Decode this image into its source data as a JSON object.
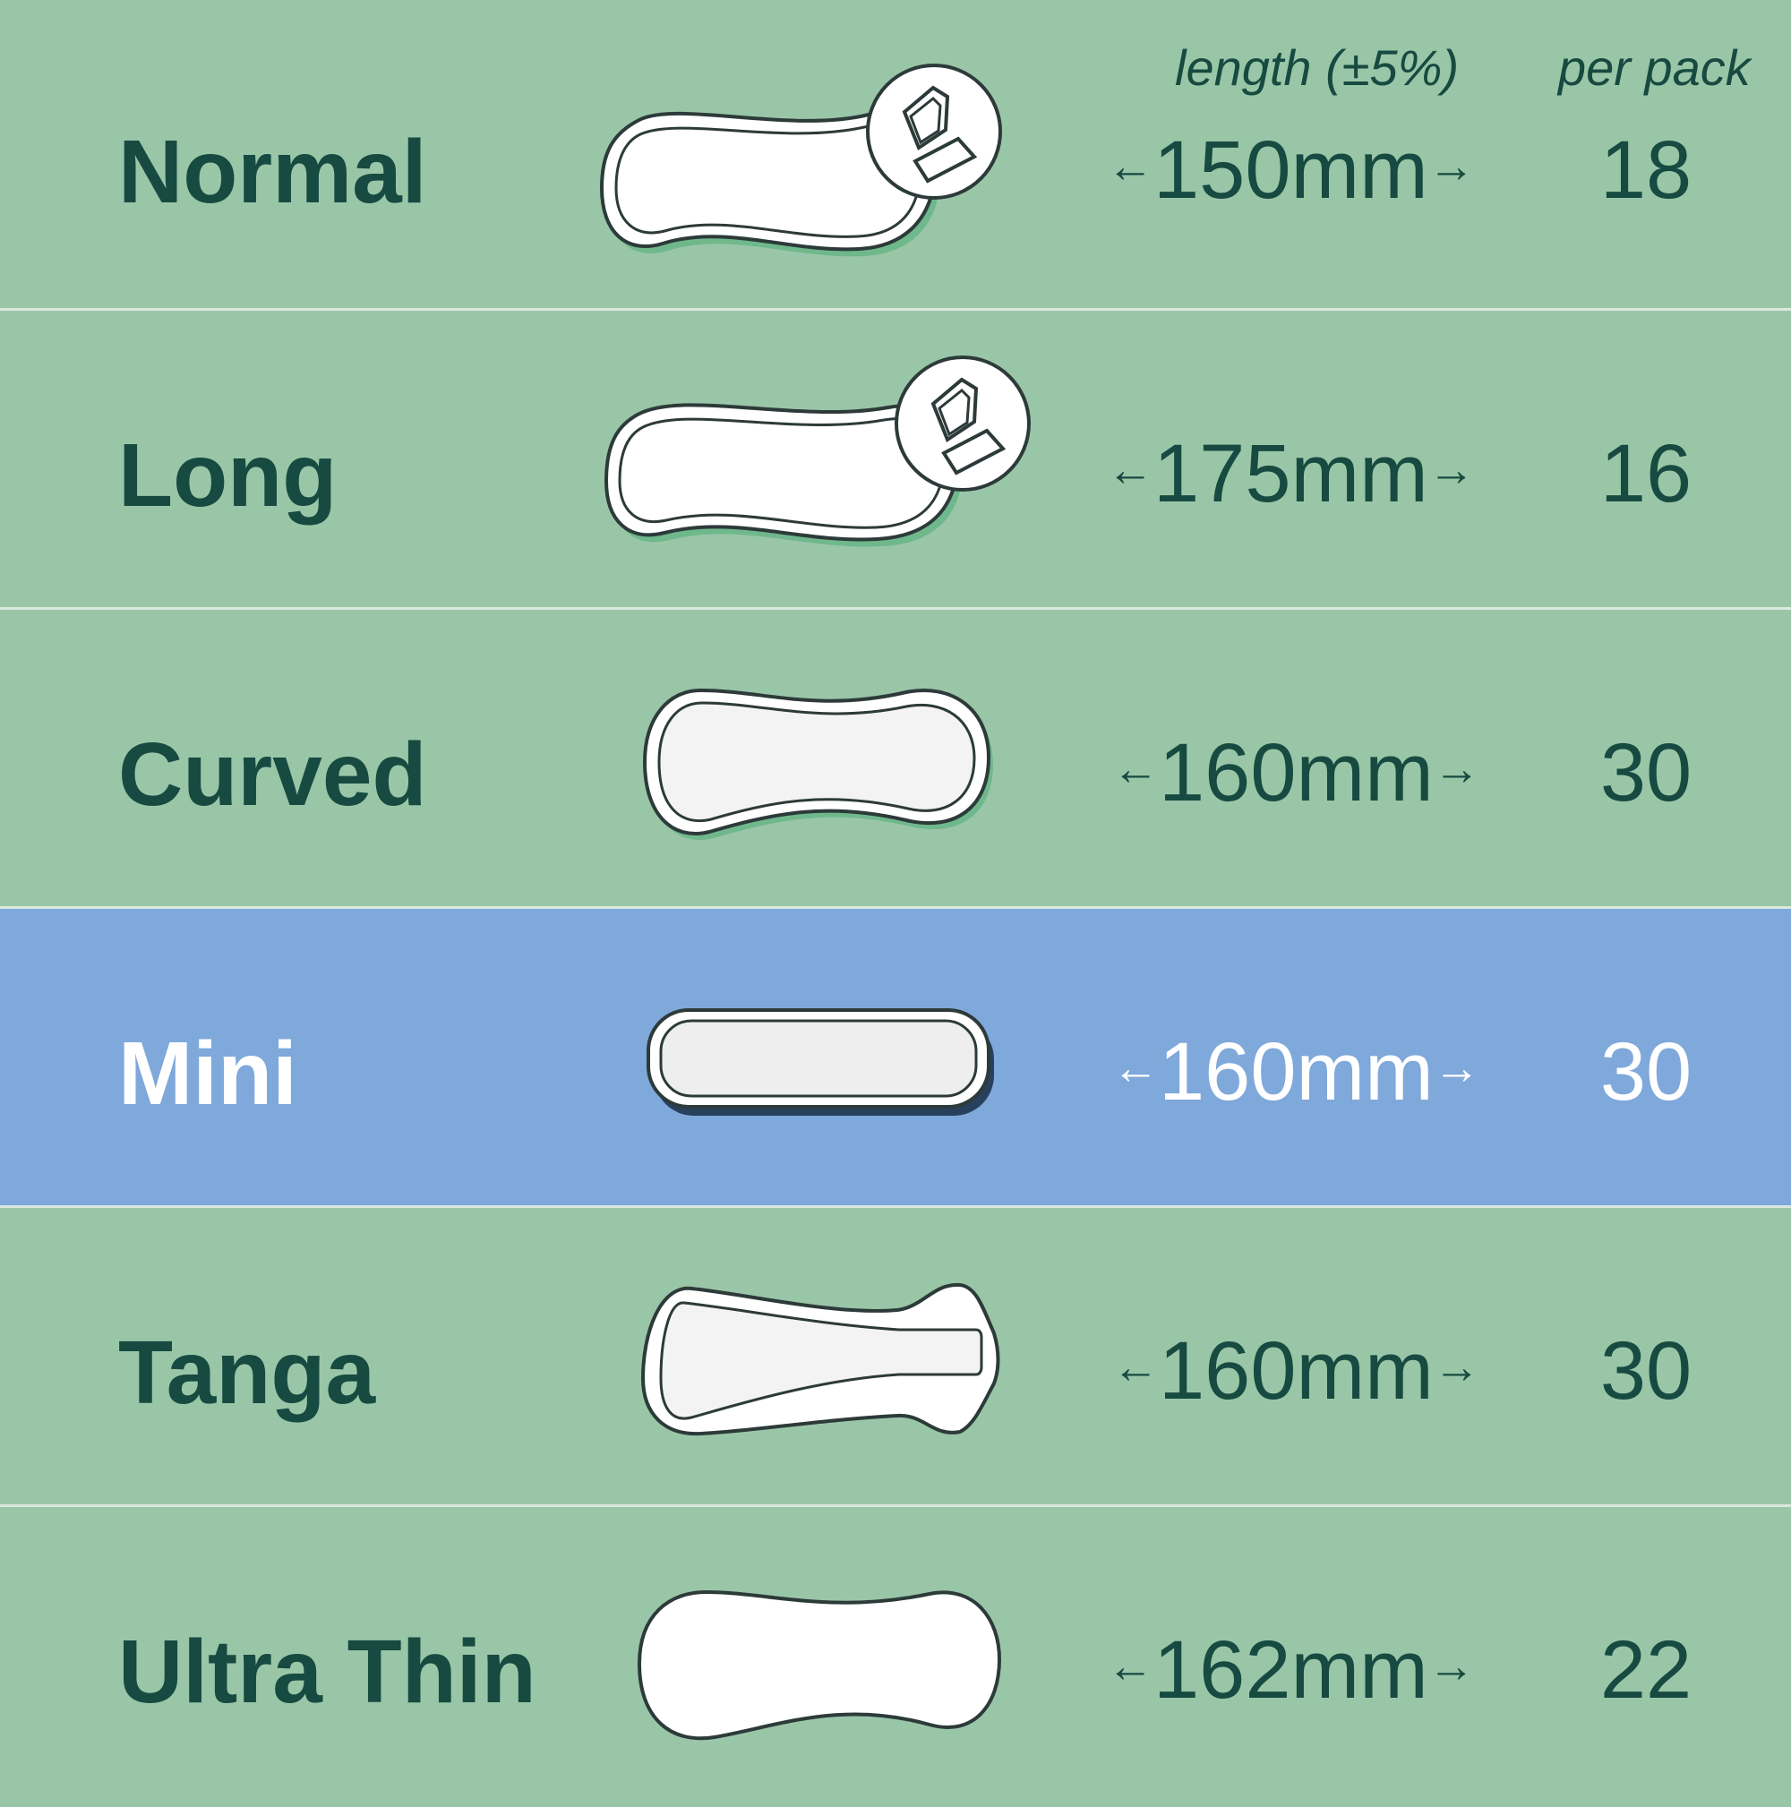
{
  "header": {
    "length_label": "length (±5%)",
    "per_pack_label": "per pack"
  },
  "arrows": {
    "left": "←",
    "right": "→"
  },
  "colors": {
    "row_background": "#9ac6a8",
    "highlight_background": "#7fa8db",
    "text_dark": "#174a40",
    "text_light": "#ffffff",
    "divider": "#dbe8df"
  },
  "products": [
    {
      "name": "Normal",
      "length": "150mm",
      "count": "18",
      "icon": "liner-wrapped-icon",
      "highlighted": false
    },
    {
      "name": "Long",
      "length": "175mm",
      "count": "16",
      "icon": "liner-wrapped-icon",
      "highlighted": false
    },
    {
      "name": "Curved",
      "length": "160mm",
      "count": "30",
      "icon": "liner-curved-icon",
      "highlighted": false
    },
    {
      "name": "Mini",
      "length": "160mm",
      "count": "30",
      "icon": "liner-mini-icon",
      "highlighted": true
    },
    {
      "name": "Tanga",
      "length": "160mm",
      "count": "30",
      "icon": "liner-tanga-icon",
      "highlighted": false
    },
    {
      "name": "Ultra Thin",
      "length": "162mm",
      "count": "22",
      "icon": "liner-ultrathin-icon",
      "highlighted": false
    }
  ]
}
